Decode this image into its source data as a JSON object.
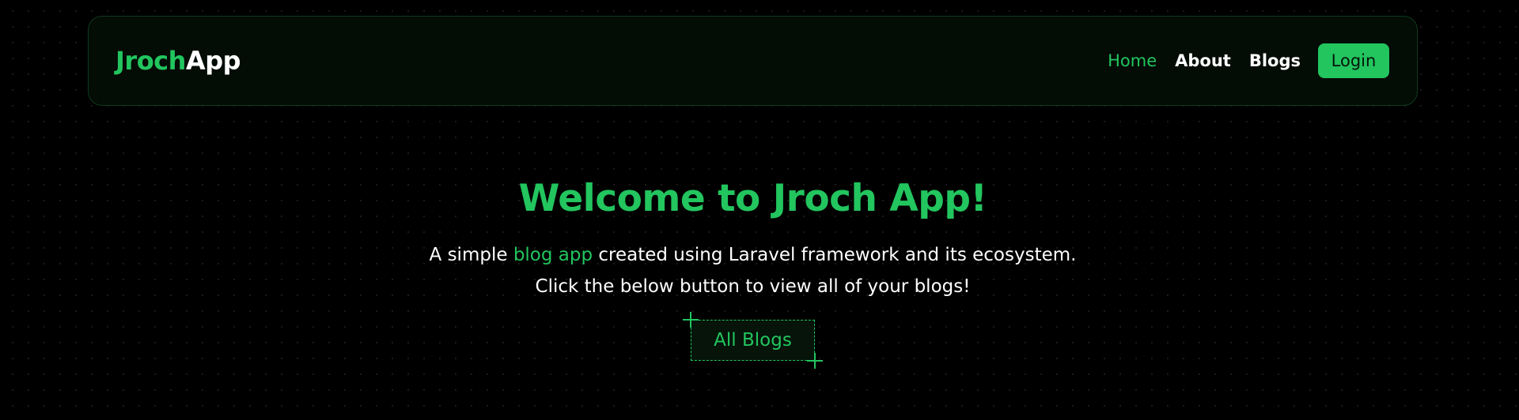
{
  "brand": {
    "part1": "Jroch",
    "part2": "App"
  },
  "nav": {
    "items": [
      {
        "label": "Home",
        "active": true
      },
      {
        "label": "About",
        "active": false
      },
      {
        "label": "Blogs",
        "active": false
      }
    ],
    "login_label": "Login"
  },
  "hero": {
    "title": "Welcome to Jroch App!",
    "line1_prefix": "A simple",
    "line1_highlight": "blog app",
    "line1_suffix": "created using Laravel framework and its ecosystem.",
    "line2": "Click the below button to view all of your blogs!",
    "cta_label": "All Blogs"
  },
  "colors": {
    "accent": "#22c55e",
    "background": "#000000",
    "text": "#ffffff"
  }
}
